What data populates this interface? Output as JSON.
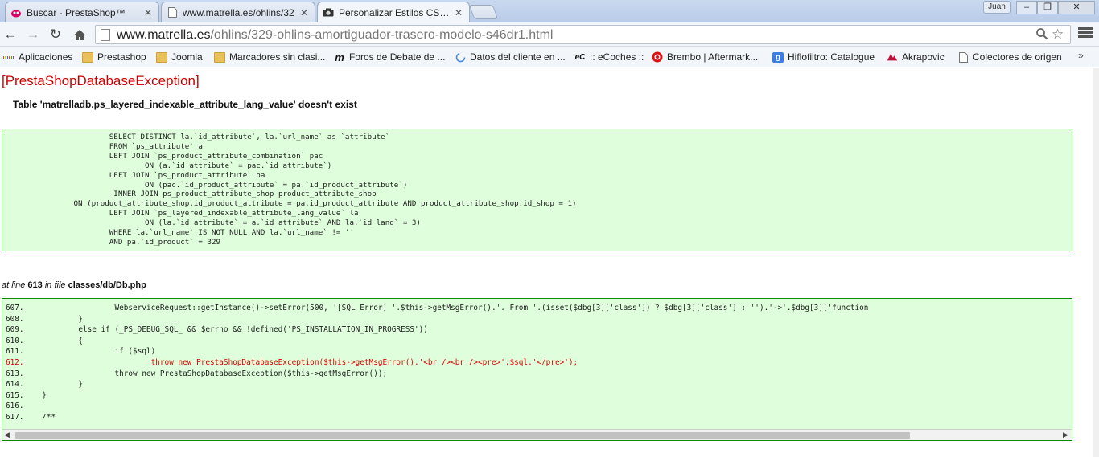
{
  "tabs": [
    {
      "title": "Buscar - PrestaShop™",
      "favicon": "prestashop-icon"
    },
    {
      "title": "www.matrella.es/ohlins/32",
      "favicon": "page-icon"
    },
    {
      "title": "Personalizar Estilos CSS en",
      "favicon": "camera-icon"
    }
  ],
  "window": {
    "profile_name": "Juan"
  },
  "omnibox": {
    "url_domain": "www.matrella.es",
    "url_path": "/ohlins/329-ohlins-amortiguador-trasero-modelo-s46dr1.html"
  },
  "bookmarks": [
    {
      "label": "Aplicaciones",
      "icon": "apps-icon"
    },
    {
      "label": "Prestashop",
      "icon": "folder-icon"
    },
    {
      "label": "Joomla",
      "icon": "folder-icon"
    },
    {
      "label": "Marcadores sin clasi...",
      "icon": "folder-icon"
    },
    {
      "label": "Foros de Debate de ...",
      "icon": "m-logo-icon"
    },
    {
      "label": "Datos del cliente en ...",
      "icon": "loading-icon"
    },
    {
      "label": ":: eCoches ::",
      "icon": "ecoches-icon"
    },
    {
      "label": "Brembo | Aftermark...",
      "icon": "brembo-icon"
    },
    {
      "label": "Hiflofiltro: Catalogue",
      "icon": "google-icon"
    },
    {
      "label": "Akrapovic",
      "icon": "akrapovic-icon"
    },
    {
      "label": "Colectores de origen",
      "icon": "page-icon"
    }
  ],
  "bookmarks_more": "»",
  "error": {
    "title": "[PrestaShopDatabaseException]",
    "message": "Table 'matrelladb.ps_layered_indexable_attribute_lang_value' doesn't exist",
    "sql": "\t\t\tSELECT DISTINCT la.`id_attribute`, la.`url_name` as `attribute`\n\t\t\tFROM `ps_attribute` a\n\t\t\tLEFT JOIN `ps_product_attribute_combination` pac\n\t\t\t\tON (a.`id_attribute` = pac.`id_attribute`)\n\t\t\tLEFT JOIN `ps_product_attribute` pa\n\t\t\t\tON (pac.`id_product_attribute` = pa.`id_product_attribute`)\n\t\t\t INNER JOIN ps_product_attribute_shop product_attribute_shop\n\t\tON (product_attribute_shop.id_product_attribute = pa.id_product_attribute AND product_attribute_shop.id_shop = 1)\n\t\t\tLEFT JOIN `ps_layered_indexable_attribute_lang_value` la\n\t\t\t\tON (la.`id_attribute` = a.`id_attribute` AND la.`id_lang` = 3)\n\t\t\tWHERE la.`url_name` IS NOT NULL AND la.`url_name` != ''\n\t\t\tAND pa.`id_product` = 329",
    "location": {
      "prefix": "at line",
      "line": "613",
      "mid": "in file",
      "file": "classes/db/Db.php"
    },
    "code_lines": [
      {
        "text": "607.\t\t\tWebserviceRequest::getInstance()->setError(500, '[SQL Error] '.$this->getMsgError().'. From '.(isset($dbg[3]['class']) ? $dbg[3]['class'] : '').'->'.$dbg[3]['function",
        "highlight": false
      },
      {
        "text": "608.\t\t}",
        "highlight": false
      },
      {
        "text": "609.\t\telse if (_PS_DEBUG_SQL_ && $errno && !defined('PS_INSTALLATION_IN_PROGRESS'))",
        "highlight": false
      },
      {
        "text": "610.\t\t{",
        "highlight": false
      },
      {
        "text": "611.\t\t\tif ($sql)",
        "highlight": false
      },
      {
        "text": "612.\t\t\t\tthrow new PrestaShopDatabaseException($this->getMsgError().'<br /><br /><pre>'.$sql.'</pre>');",
        "highlight": true
      },
      {
        "text": "613.\t\t\tthrow new PrestaShopDatabaseException($this->getMsgError());",
        "highlight": false
      },
      {
        "text": "614.\t\t}",
        "highlight": false
      },
      {
        "text": "615.\t}",
        "highlight": false
      },
      {
        "text": "616.",
        "highlight": false
      },
      {
        "text": "617.\t/**",
        "highlight": false
      }
    ]
  }
}
